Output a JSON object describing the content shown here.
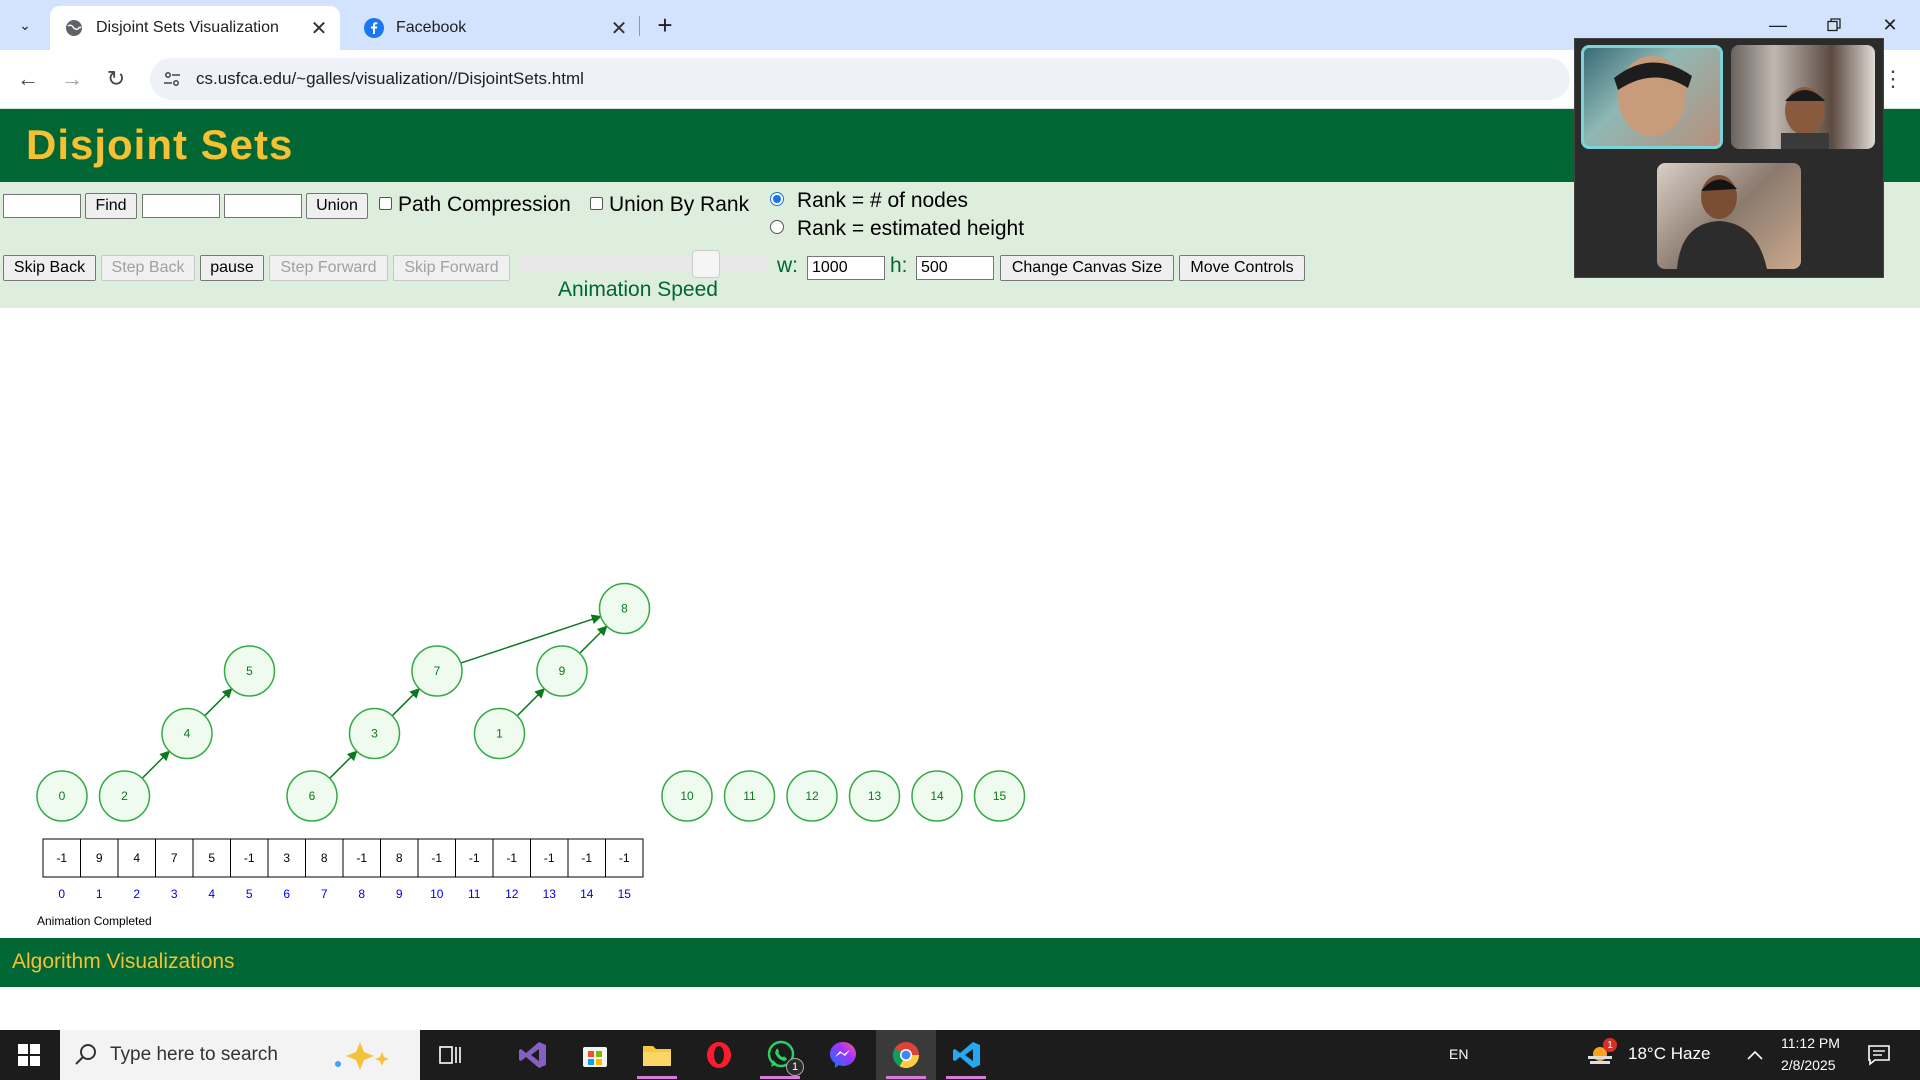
{
  "browser": {
    "tabs": [
      {
        "title": "Disjoint Sets Visualization",
        "active": true
      },
      {
        "title": "Facebook",
        "active": false
      }
    ],
    "new_tab": "+",
    "url": "cs.usfca.edu/~galles/visualization//DisjointSets.html"
  },
  "page": {
    "title": "Disjoint Sets",
    "controls": {
      "find_label": "Find",
      "union_label": "Union",
      "path_compression_label": "Path Compression",
      "union_by_rank_label": "Union By Rank",
      "rank_nodes_label": "Rank = # of nodes",
      "rank_height_label": "Rank = estimated height",
      "skip_back_label": "Skip Back",
      "step_back_label": "Step Back",
      "pause_label": "pause",
      "step_forward_label": "Step Forward",
      "skip_forward_label": "Skip Forward",
      "animation_speed_label": "Animation Speed",
      "animation_speed_value": 0.78,
      "w_label": "w:",
      "w_value": "1000",
      "h_label": "h:",
      "h_value": "500",
      "change_canvas_label": "Change Canvas Size",
      "move_controls_label": "Move Controls"
    },
    "visualization": {
      "parent_array": [
        "-1",
        "9",
        "4",
        "7",
        "5",
        "-1",
        "3",
        "8",
        "-1",
        "8",
        "-1",
        "-1",
        "-1",
        "-1",
        "-1",
        "-1"
      ],
      "indices": [
        "0",
        "1",
        "2",
        "3",
        "4",
        "5",
        "6",
        "7",
        "8",
        "9",
        "10",
        "11",
        "12",
        "13",
        "14",
        "15"
      ],
      "status": "Animation Completed"
    },
    "footer_title": "Algorithm Visualizations"
  },
  "taskbar": {
    "search_placeholder": "Type here to search",
    "language": "EN",
    "weather": "18°C  Haze",
    "time": "11:12 PM",
    "date": "2/8/2025",
    "whatsapp_badge": "1",
    "weather_badge": "1"
  },
  "colors": {
    "header_green": "#006633",
    "title_gold": "#f5c033",
    "controls_bg": "#ddeedd",
    "node_fill": "#eefbee",
    "node_stroke": "#33aa44"
  }
}
